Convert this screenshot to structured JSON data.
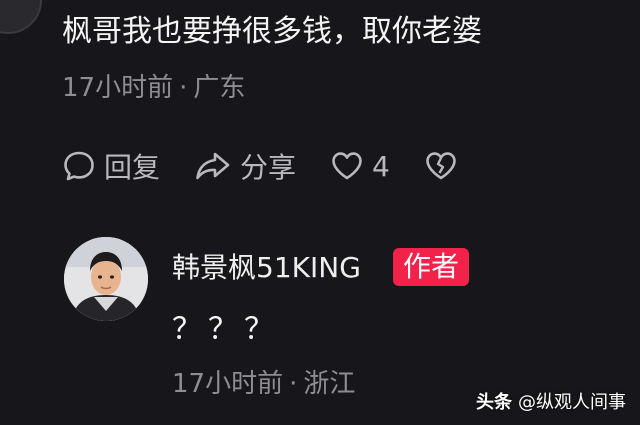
{
  "comment": {
    "text": "枫哥我也要挣很多钱，取你老婆",
    "time": "17小时前",
    "location": "广东",
    "reply_label": "回复",
    "share_label": "分享",
    "like_count": "4"
  },
  "reply": {
    "author_name": "韩景枫51KING",
    "author_badge": "作者",
    "text": "？？？",
    "time": "17小时前",
    "location": "浙江"
  },
  "watermark": {
    "brand": "头条",
    "account": "@纵观人间事"
  },
  "colors": {
    "background": "#17171b",
    "badge": "#f2224a",
    "meta": "#8d8d92"
  },
  "icons": {
    "reply": "comment-bubble-icon",
    "share": "share-arrow-icon",
    "like": "heart-icon",
    "dislike": "broken-heart-icon"
  }
}
